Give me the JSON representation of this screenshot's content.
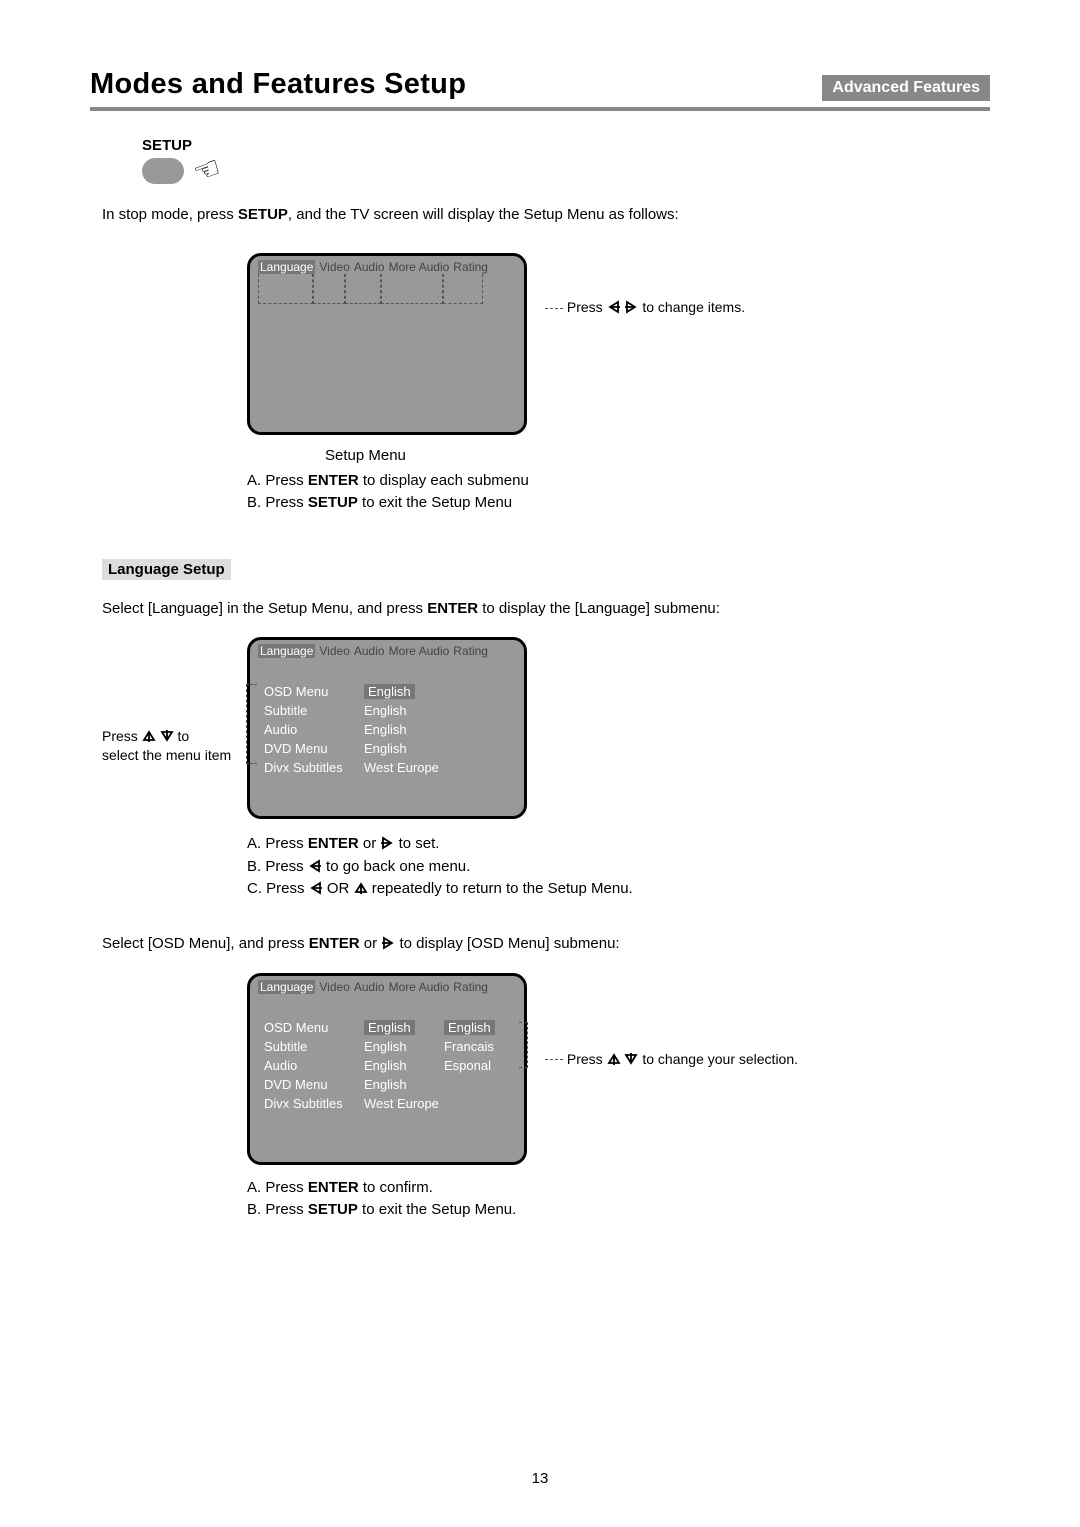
{
  "header": {
    "title": "Modes and Features Setup",
    "badge": "Advanced Features"
  },
  "setup_label": "SETUP",
  "intro_1a": "In stop mode, press ",
  "intro_1b": "SETUP",
  "intro_1c": ", and the TV screen will display the Setup Menu as follows:",
  "osd_tabs": {
    "t0": "Language",
    "t1": "Video",
    "t2": "Audio",
    "t3": "More Audio",
    "t4": "Rating"
  },
  "note_change_items_a": "Press ",
  "note_change_items_b": " to change items.",
  "caption_setup_menu": "Setup Menu",
  "note_A1a": "A. Press ",
  "note_A1b": "ENTER",
  "note_A1c": " to display each submenu",
  "note_B1a": "B. Press ",
  "note_B1b": "SETUP",
  "note_B1c": " to exit the Setup Menu",
  "section_lang": "Language Setup",
  "para_lang_a": "Select [Language] in the Setup Menu, and press ",
  "para_lang_b": "ENTER",
  "para_lang_c": " to display the [Language] submenu:",
  "left_note_a": "Press ",
  "left_note_b": " to select the menu item",
  "osd2_rows": {
    "r0": {
      "l": "OSD Menu",
      "v": "English",
      "hl": true
    },
    "r1": {
      "l": "Subtitle",
      "v": "English"
    },
    "r2": {
      "l": "Audio",
      "v": "English"
    },
    "r3": {
      "l": "DVD Menu",
      "v": "English"
    },
    "r4": {
      "l": "Divx Subtitles",
      "v": "West Europe"
    }
  },
  "notes2": {
    "Aa": "A. Press ",
    "Ab": "ENTER",
    "Ac": " or ",
    "Ad": " to set.",
    "Ba": "B. Press  ",
    "Bb": " to go back one menu.",
    "Ca": "C. Press  ",
    "Cb": " OR ",
    "Cc": " repeatedly to return to the Setup Menu."
  },
  "para_osd_a": "Select [OSD Menu], and press ",
  "para_osd_b": "ENTER",
  "para_osd_c": " or ",
  "para_osd_d": " to display [OSD Menu] submenu:",
  "osd3_rows": {
    "r0": {
      "l": "OSD Menu",
      "v": "English",
      "o": "English",
      "hl": true
    },
    "r1": {
      "l": "Subtitle",
      "v": "English",
      "o": "Francais"
    },
    "r2": {
      "l": "Audio",
      "v": "English",
      "o": "Esponal"
    },
    "r3": {
      "l": "DVD Menu",
      "v": "English",
      "o": ""
    },
    "r4": {
      "l": "Divx Subtitles",
      "v": "West Europe",
      "o": ""
    }
  },
  "right_note3_a": "Press ",
  "right_note3_b": " to change your selection.",
  "notes3": {
    "Aa": "A. Press ",
    "Ab": "ENTER",
    "Ac": " to confirm.",
    "Ba": "B. Press ",
    "Bb": "SETUP",
    "Bc": " to exit the Setup Menu."
  },
  "page_number": "13"
}
